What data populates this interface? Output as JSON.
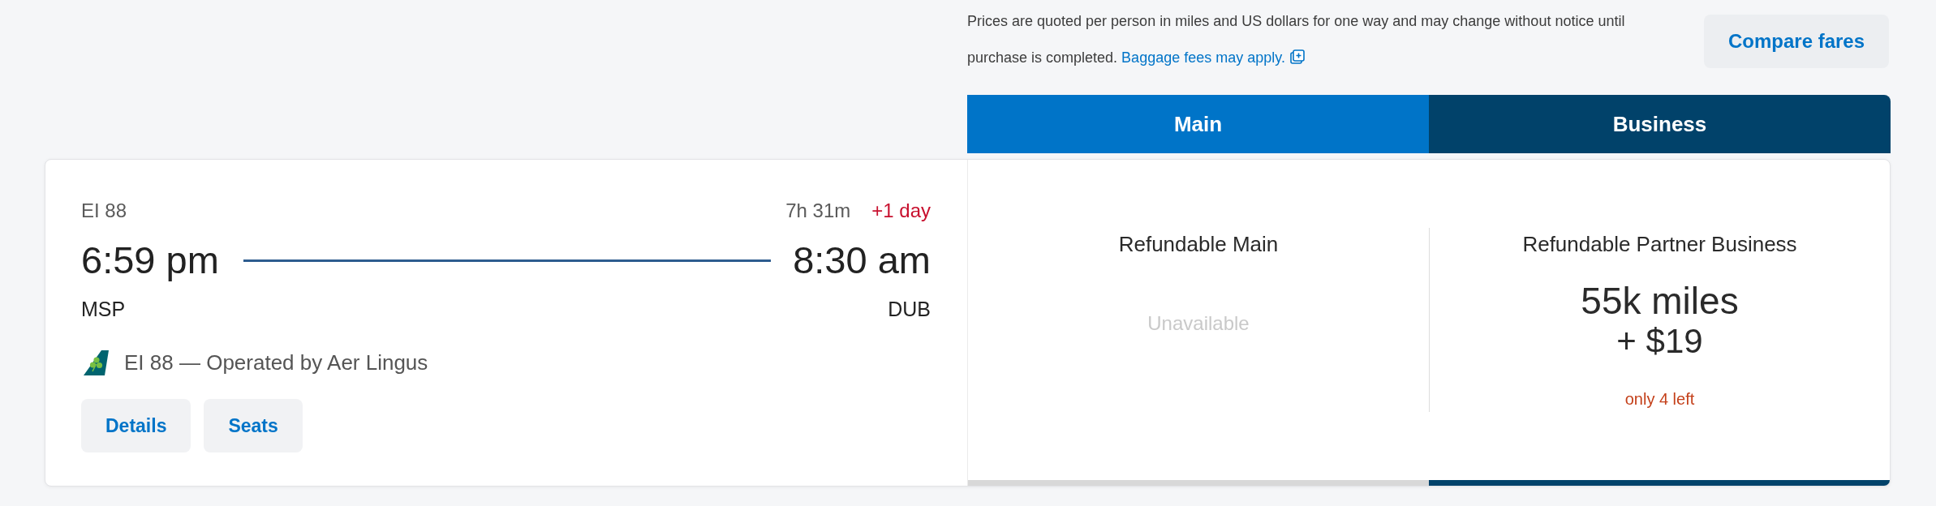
{
  "notice": {
    "text": "Prices are quoted per person in miles and US dollars for one way and may change without notice until purchase is completed.",
    "link": "Baggage fees may apply."
  },
  "compare_button": "Compare fares",
  "cabins": [
    {
      "label": "Main",
      "color": "#0074c8"
    },
    {
      "label": "Business",
      "color": "#01426a"
    }
  ],
  "flight": {
    "flight_number": "EI 88",
    "duration": "7h 31m",
    "day_change": "+1 day",
    "depart_time": "6:59 pm",
    "arrive_time": "8:30 am",
    "origin": "MSP",
    "destination": "DUB",
    "operator": "EI 88 — Operated by Aer Lingus",
    "buttons": [
      "Details",
      "Seats"
    ]
  },
  "fares": [
    {
      "name": "Refundable Main",
      "available": false,
      "status": "Unavailable"
    },
    {
      "name": "Refundable Partner Business",
      "available": true,
      "miles": "55k miles",
      "cash": "+ $19",
      "seats_left": "only 4 left"
    }
  ]
}
